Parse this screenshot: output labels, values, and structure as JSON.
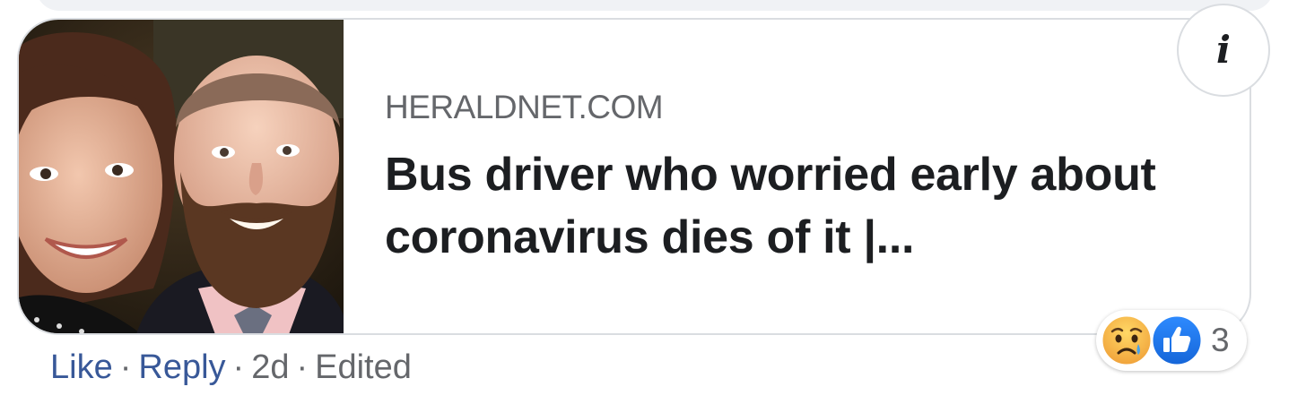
{
  "link_preview": {
    "domain": "HERALDNET.COM",
    "headline": "Bus driver who worried early about coronavirus dies of it |..."
  },
  "comment_actions": {
    "like": "Like",
    "reply": "Reply",
    "time": "2d",
    "edited": "Edited",
    "separator": "·"
  },
  "reactions": {
    "icons": [
      "sad-reaction-icon",
      "like-reaction-icon"
    ],
    "count": "3"
  },
  "colors": {
    "link_blue": "#385898",
    "secondary_text": "#65676b",
    "primary_text": "#1c1e21",
    "like_blue": "#1877f2",
    "card_border": "#dadde1"
  }
}
